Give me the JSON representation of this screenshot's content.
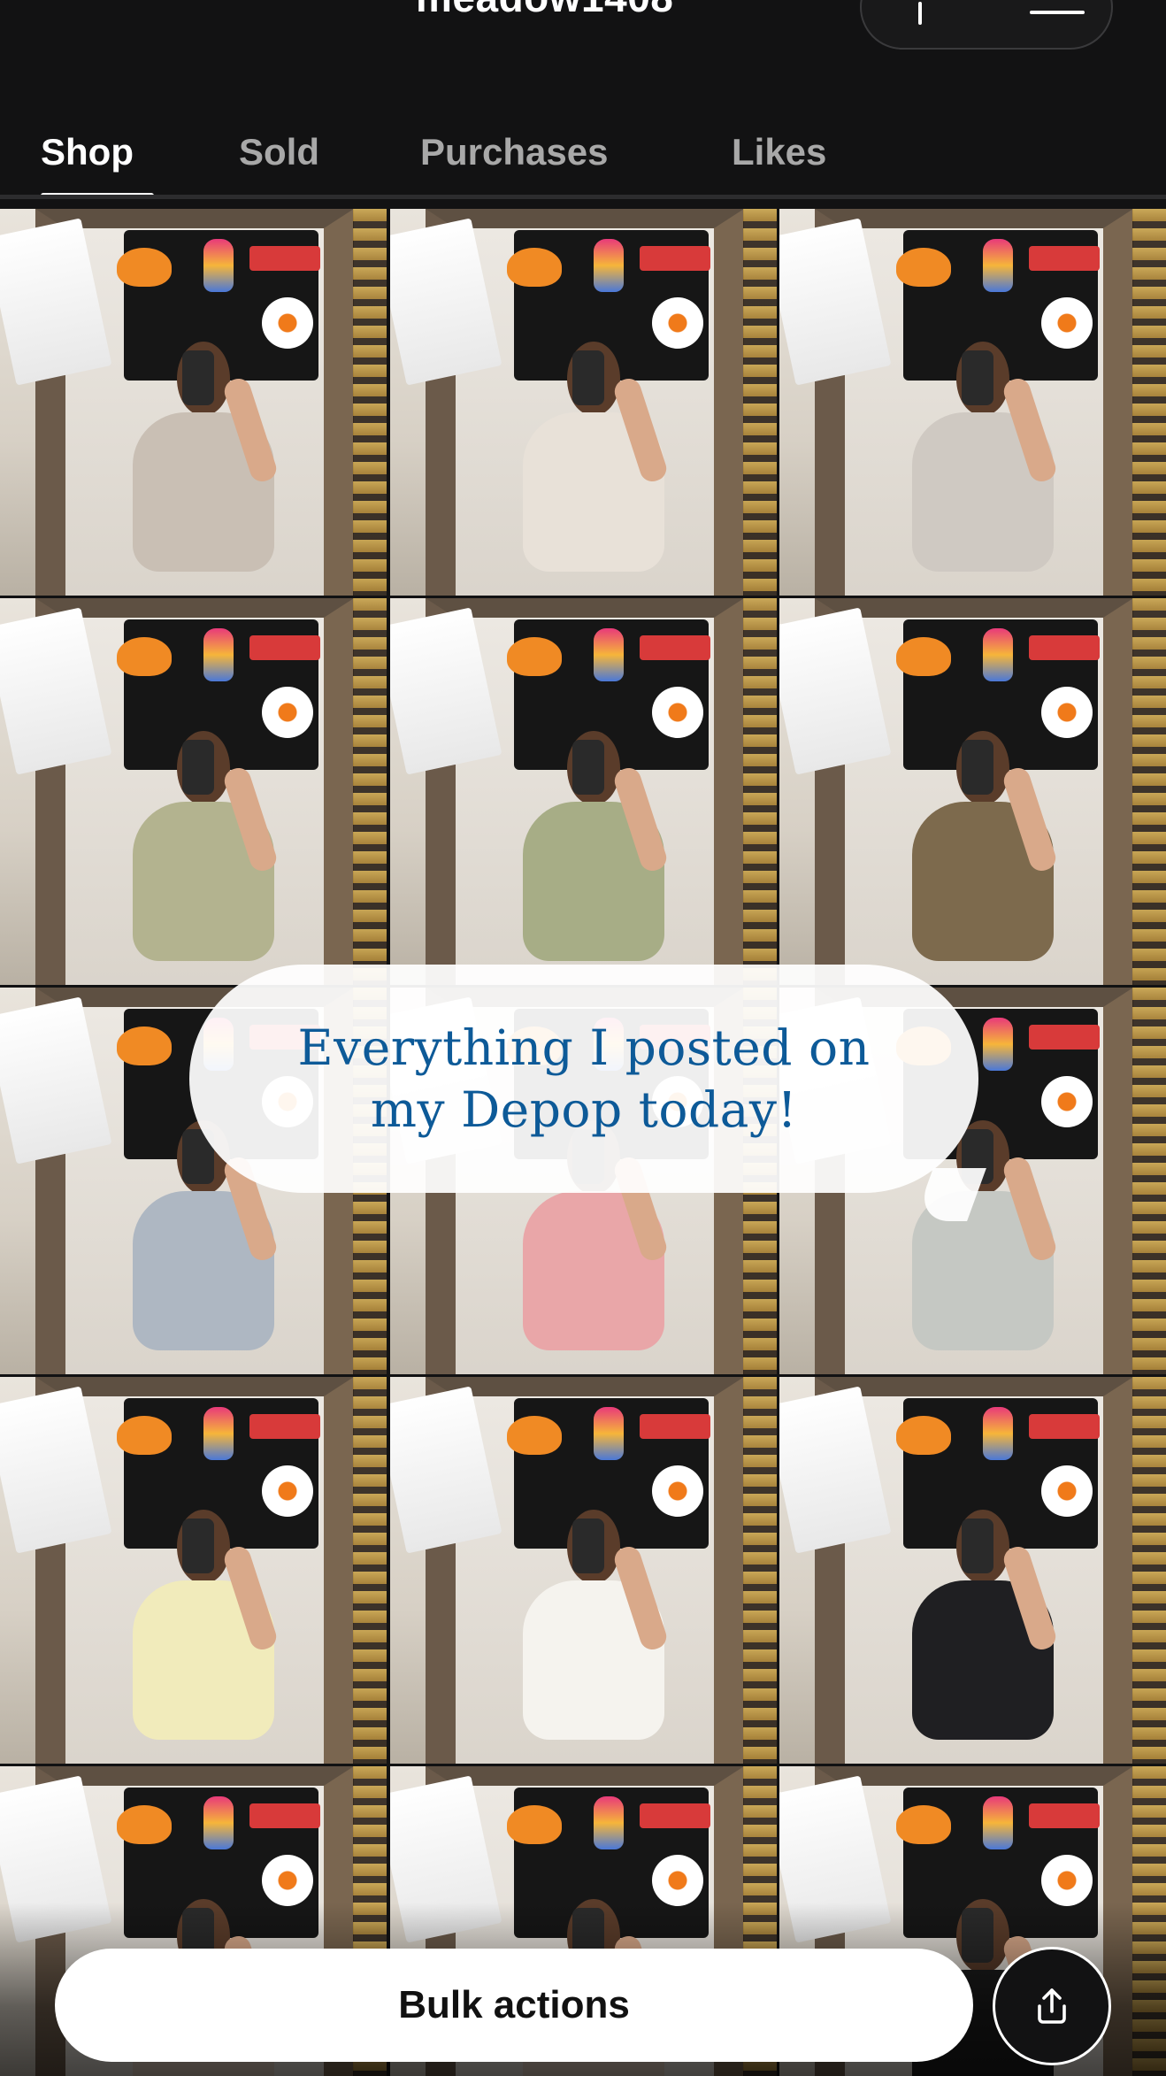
{
  "header": {
    "username": "meadow1408"
  },
  "tabs": [
    {
      "label": "Shop",
      "active": true
    },
    {
      "label": "Sold",
      "active": false
    },
    {
      "label": "Purchases",
      "active": false
    },
    {
      "label": "Likes",
      "active": false
    }
  ],
  "caption": {
    "line1": "Everything I posted on",
    "line2": "my Depop today!",
    "color": "#0d5a98"
  },
  "grid": {
    "items": [
      {
        "outfit": "swirl print sports bra",
        "color": "#c9bfb4"
      },
      {
        "outfit": "white sports bra with black band",
        "color": "#e8e1d8"
      },
      {
        "outfit": "heather grey crop tank",
        "color": "#cfc9c2"
      },
      {
        "outfit": "sage baby tee",
        "color": "#b3b38f"
      },
      {
        "outfit": "sage fitted tee",
        "color": "#a7ad86"
      },
      {
        "outfit": "olive square neck top",
        "color": "#7d6a4d"
      },
      {
        "outfit": "grey v-neck baby tee",
        "color": "#aeb7c2"
      },
      {
        "outfit": "pink v-neck baby tee",
        "color": "#e9a6a8"
      },
      {
        "outfit": "grey green striped sweater",
        "color": "#c5c8c3"
      },
      {
        "outfit": "pale yellow quarter zip",
        "color": "#f1ebbb"
      },
      {
        "outfit": "white star sweater",
        "color": "#f5f3ee"
      },
      {
        "outfit": "black quarter zip",
        "color": "#1f1f22"
      },
      {
        "outfit": "partial listing",
        "color": "#d9c7b6"
      },
      {
        "outfit": "partial listing",
        "color": "#d9c7b6"
      },
      {
        "outfit": "black halter top",
        "color": "#1c1c1c"
      }
    ]
  },
  "actions": {
    "bulk_label": "Bulk actions",
    "share_icon": "share-upload-icon"
  }
}
